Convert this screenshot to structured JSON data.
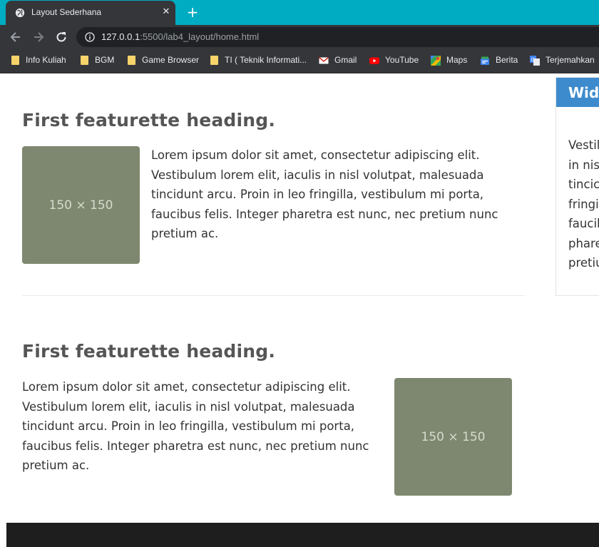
{
  "browser": {
    "tab": {
      "title": "Layout Sederhana",
      "favicon": "globe-icon",
      "close_glyph": "✕"
    },
    "new_tab_glyph": "+",
    "url": {
      "host": "127.0.0.1",
      "rest": ":5500/lab4_layout/home.html"
    },
    "bookmarks": [
      {
        "label": "Info Kuliah",
        "icon": "folder-icon"
      },
      {
        "label": "BGM",
        "icon": "folder-icon"
      },
      {
        "label": "Game Browser",
        "icon": "folder-icon"
      },
      {
        "label": "TI ( Teknik Informati...",
        "icon": "folder-icon"
      },
      {
        "label": "Gmail",
        "icon": "gmail-icon"
      },
      {
        "label": "YouTube",
        "icon": "youtube-icon"
      },
      {
        "label": "Maps",
        "icon": "maps-icon"
      },
      {
        "label": "Berita",
        "icon": "news-icon"
      },
      {
        "label": "Terjemahkan",
        "icon": "translate-icon"
      }
    ],
    "colors": {
      "tabstrip": "#00acc1",
      "toolbar": "#35363a",
      "omnibox": "#202124"
    }
  },
  "content": {
    "featurettes": [
      {
        "heading": "First featurette heading.",
        "text": "Lorem ipsum dolor sit amet, consectetur adipiscing elit. Vestibulum lorem elit, iaculis in nisl volutpat, malesuada tincidunt arcu. Proin in leo fringilla, vestibulum mi porta, faucibus felis. Integer pharetra est nunc, nec pretium nunc pretium ac.",
        "image_label": "150 × 150"
      },
      {
        "heading": "First featurette heading.",
        "text": "Lorem ipsum dolor sit amet, consectetur adipiscing elit. Vestibulum lorem elit, iaculis in nisl volutpat, malesuada tincidunt arcu. Proin in leo fringilla, vestibulum mi porta, faucibus felis. Integer pharetra est nunc, nec pretium nunc pretium ac.",
        "image_label": "150 × 150"
      }
    ],
    "widget": {
      "title": "Widg",
      "body": "Vestil\nin nis\ntincic\nfringi\nfaucil\nphare\npretiu"
    },
    "colors": {
      "placeholder": "#7e8870",
      "widget_header": "#3d8bcd",
      "footer": "#1e1e1e"
    }
  }
}
